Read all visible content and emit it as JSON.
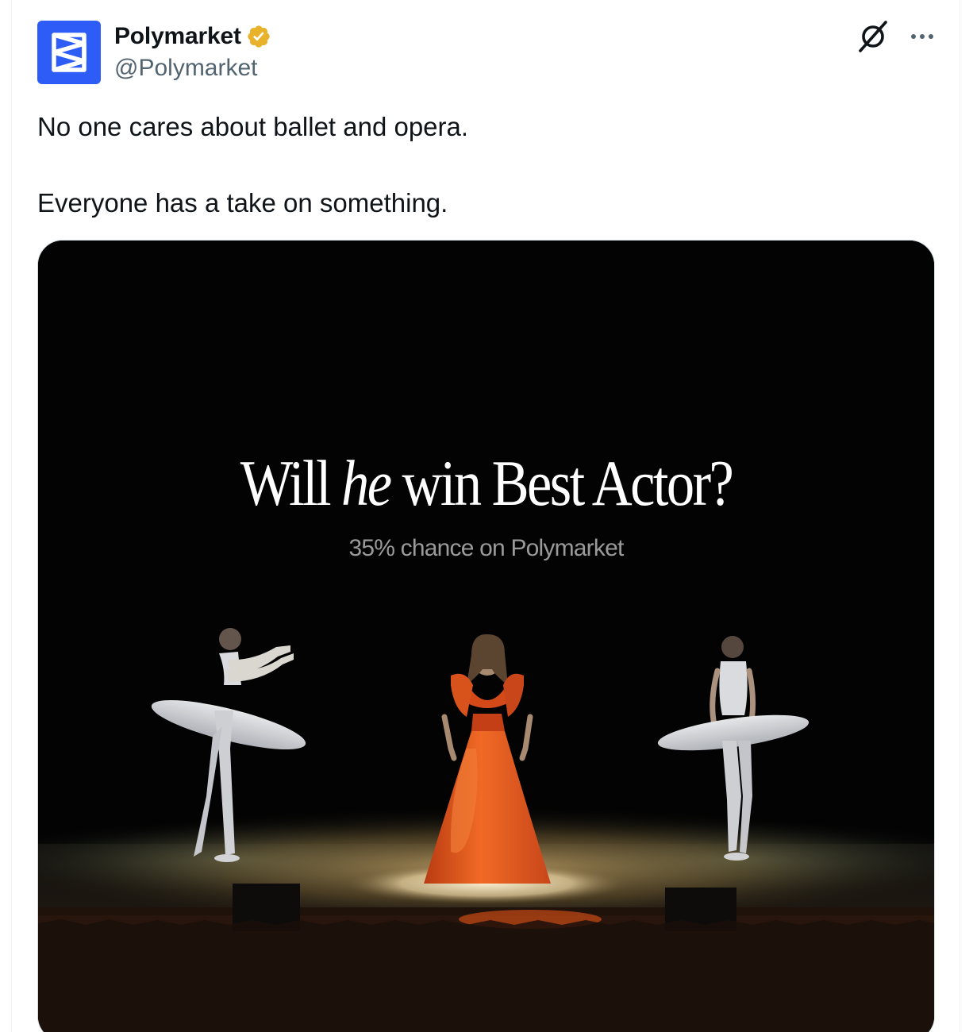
{
  "author": {
    "display_name": "Polymarket",
    "handle": "@Polymarket",
    "verified": true,
    "avatar_icon": "polymarket-logo-icon",
    "avatar_color": "#2d5cf6",
    "badge_color": "#e8b32b"
  },
  "actions": {
    "grok_icon": "grok-icon",
    "more_icon": "more-dots-icon"
  },
  "tweet": {
    "line1": "No one cares about ballet and opera.",
    "line2": "Everyone has a take on something."
  },
  "media": {
    "headline_prefix": "Will ",
    "headline_emphasis": "he",
    "headline_suffix": " win Best Actor?",
    "subline": "35% chance on Polymarket",
    "dress_color": "#e2561c"
  }
}
